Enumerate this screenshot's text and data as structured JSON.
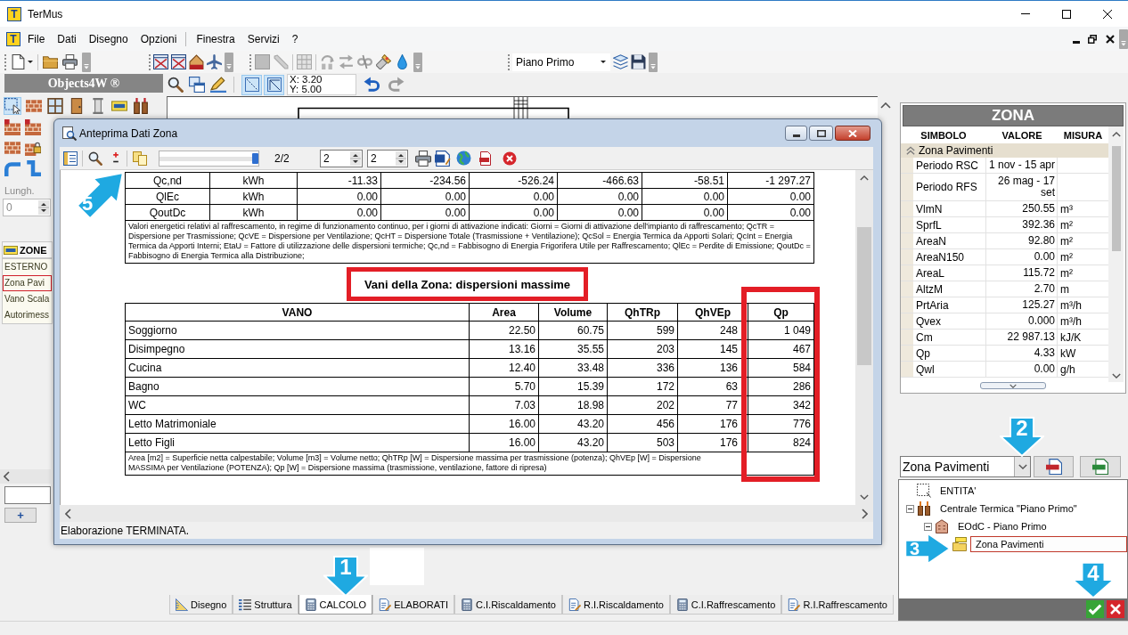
{
  "window": {
    "logo": "T",
    "title": "TerMus"
  },
  "menu": {
    "logo": "T",
    "items": [
      "File",
      "Dati",
      "Disegno",
      "Opzioni",
      "Finestra",
      "Servizi",
      "?"
    ]
  },
  "toolbar": {
    "floor": "Piano Primo",
    "snap_buttons": [
      {
        "on": true
      },
      {
        "on": true
      }
    ],
    "coords": [
      "X: 3.20",
      "Y: 5.00"
    ]
  },
  "objects_panel": {
    "title": "Objects4W ®",
    "length_label": "Lungh.",
    "length_value": "0",
    "tab": "ZONE",
    "items": [
      {
        "label": "ESTERNO",
        "selected": false
      },
      {
        "label": "Zona Pavi",
        "selected": true
      },
      {
        "label": "Vano Scala",
        "selected": false
      },
      {
        "label": "Autorimess",
        "selected": false
      }
    ],
    "add_button": "+"
  },
  "preview": {
    "title": "Anteprima Dati Zona",
    "slider": {
      "level": 1
    },
    "page": "2/2",
    "spinners": [
      "2",
      "2"
    ],
    "table_1": {
      "rows": [
        [
          "Qc,nd",
          "kWh",
          "-11.33",
          "-234.56",
          "-526.24",
          "-466.63",
          "-58.51",
          "-1 297.27"
        ],
        [
          "QlEc",
          "kWh",
          "0.00",
          "0.00",
          "0.00",
          "0.00",
          "0.00",
          "0.00"
        ],
        [
          "QoutDc",
          "kWh",
          "0.00",
          "0.00",
          "0.00",
          "0.00",
          "0.00",
          "0.00"
        ]
      ],
      "note": "Valori energetici relativi al raffrescamento, in regime di funzionamento continuo, per i giorni di attivazione indicati: Giorni = Giorni di attivazione dell'impianto di raffrescamento; QcTR = Dispersione per Trasmissione; QcVE = Dispersione per Ventilazione; QcHT = Dispersione Totale (Trasmissione + Ventilazione); QcSol = Energia Termica da Apporti Solari; QcInt = Energia Termica da Apporti Interni; EtaU = Fattore di utilizzazione delle dispersioni termiche; Qc,nd = Fabbisogno di Energia Frigorifera Utile per Raffrescamento; QlEc = Perdite di Emissione; QoutDc = Fabbisogno di Energia Termica alla Distribuzione;"
    },
    "section_title": {
      "text": "Vani della Zona: dispersioni massime",
      "highlighted": true
    },
    "table_2": {
      "columns": [
        {
          "label": "VANO",
          "highlighted": false
        },
        {
          "label": "Area",
          "highlighted": false
        },
        {
          "label": "Volume",
          "highlighted": false
        },
        {
          "label": "QhTRp",
          "highlighted": false
        },
        {
          "label": "QhVEp",
          "highlighted": false
        },
        {
          "label": "Qp",
          "highlighted": true
        }
      ],
      "rows": [
        [
          "Soggiorno",
          "22.50",
          "60.75",
          "599",
          "248",
          "1 049"
        ],
        [
          "Disimpegno",
          "13.16",
          "35.55",
          "203",
          "145",
          "467"
        ],
        [
          "Cucina",
          "12.40",
          "33.48",
          "336",
          "136",
          "584"
        ],
        [
          "Bagno",
          "5.70",
          "15.39",
          "172",
          "63",
          "286"
        ],
        [
          "WC",
          "7.03",
          "18.98",
          "202",
          "77",
          "342"
        ],
        [
          "Letto Matrimoniale",
          "16.00",
          "43.20",
          "456",
          "176",
          "776"
        ],
        [
          "Letto Figli",
          "16.00",
          "43.20",
          "503",
          "176",
          "824"
        ]
      ],
      "note": "Area [m2] = Superficie netta calpestabile; Volume [m3] = Volume netto; QhTRp [W] = Dispersione massima per trasmissione (potenza); QhVEp [W] = Dispersione MASSIMA per Ventilazione (POTENZA); Qp [W] = Dispersione massima (trasmissione, ventilazione, fattore di ripresa)"
    },
    "status": "Elaborazione TERMINATA."
  },
  "zone_panel": {
    "title": "ZONA",
    "columns": [
      "SIMBOLO",
      "VALORE",
      "MISURA"
    ],
    "group": {
      "label": "Zona Pavimenti",
      "expanded": true
    },
    "rows": [
      {
        "symbol": "Periodo RSC",
        "value": "1 nov - 15 apr"
      },
      {
        "symbol": "Periodo RFS",
        "value": "26 mag - 17 set"
      },
      {
        "symbol": "VlmN",
        "value": "250.55",
        "unit": "m³"
      },
      {
        "symbol": "SprfL",
        "value": "392.36",
        "unit": "m²"
      },
      {
        "symbol": "AreaN",
        "value": "92.80",
        "unit": "m²"
      },
      {
        "symbol": "AreaN150",
        "value": "0.00",
        "unit": "m²"
      },
      {
        "symbol": "AreaL",
        "value": "115.72",
        "unit": "m²"
      },
      {
        "symbol": "AltzM",
        "value": "2.70",
        "unit": "m"
      },
      {
        "symbol": "PrtAria",
        "value": "125.27",
        "unit": "m³/h"
      },
      {
        "symbol": "Qvex",
        "value": "0.000",
        "unit": "m³/h"
      },
      {
        "symbol": "Cm",
        "value": "22 987.13",
        "unit": "kJ/K"
      },
      {
        "symbol": "Qp",
        "value": "4.33",
        "unit": "kW"
      },
      {
        "symbol": "Qwl",
        "value": "0.00",
        "unit": "g/h"
      }
    ]
  },
  "zone_select": "Zona Pavimenti",
  "tree": [
    {
      "label": "ENTITA'",
      "kind": "entity",
      "selected": false
    },
    {
      "label": "Centrale Termica \"Piano Primo\"",
      "kind": "plant",
      "selected": false,
      "expanded": true,
      "children": [
        {
          "label": "EOdC - Piano Primo",
          "kind": "building",
          "selected": false,
          "expanded": true,
          "children": [
            {
              "label": "Zona Pavimenti",
              "kind": "zone",
              "selected": true
            }
          ]
        }
      ]
    }
  ],
  "tabs": [
    {
      "label": "Disegno",
      "selected": false
    },
    {
      "label": "Struttura",
      "selected": false
    },
    {
      "label": "CALCOLO",
      "selected": true
    },
    {
      "label": "ELABORATI",
      "selected": false
    },
    {
      "label": "C.I.Riscaldamento",
      "selected": false
    },
    {
      "label": "R.I.Riscaldamento",
      "selected": false
    },
    {
      "label": "C.I.Raffrescamento",
      "selected": false
    },
    {
      "label": "R.I.Raffrescamento",
      "selected": false
    }
  ],
  "callouts": [
    {
      "number": "1",
      "kind": "down"
    },
    {
      "number": "2",
      "kind": "down"
    },
    {
      "number": "3",
      "kind": "right"
    },
    {
      "number": "4",
      "kind": "down"
    },
    {
      "number": "5",
      "kind": "diagonal"
    }
  ]
}
